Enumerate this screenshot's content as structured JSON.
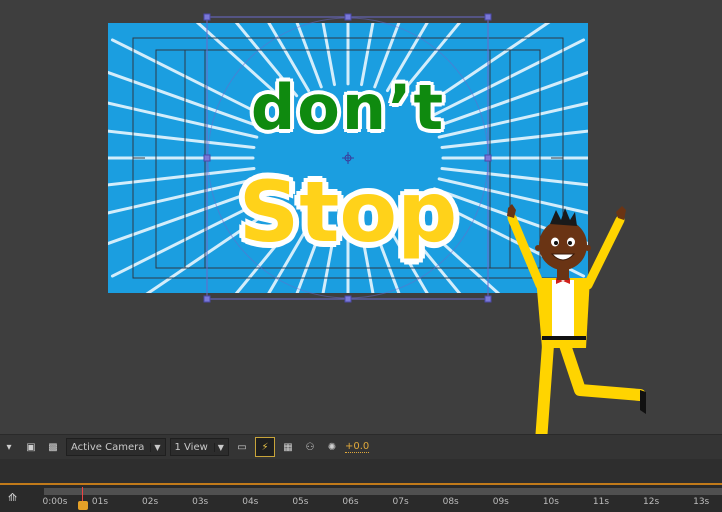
{
  "composition": {
    "line1": "don’t",
    "line2": "Stop",
    "bg_color": "#1b9ee0",
    "line1_color": "#0f8a0f",
    "line2_color": "#ffd21a"
  },
  "toolbar": {
    "camera_label": "Active Camera",
    "view_label": "1 View",
    "exposure": "+0.0"
  },
  "timeline": {
    "ticks": [
      "0:00s",
      "01s",
      "02s",
      "03s",
      "04s",
      "05s",
      "06s",
      "07s",
      "08s",
      "09s",
      "10s",
      "11s",
      "12s",
      "13s"
    ]
  }
}
